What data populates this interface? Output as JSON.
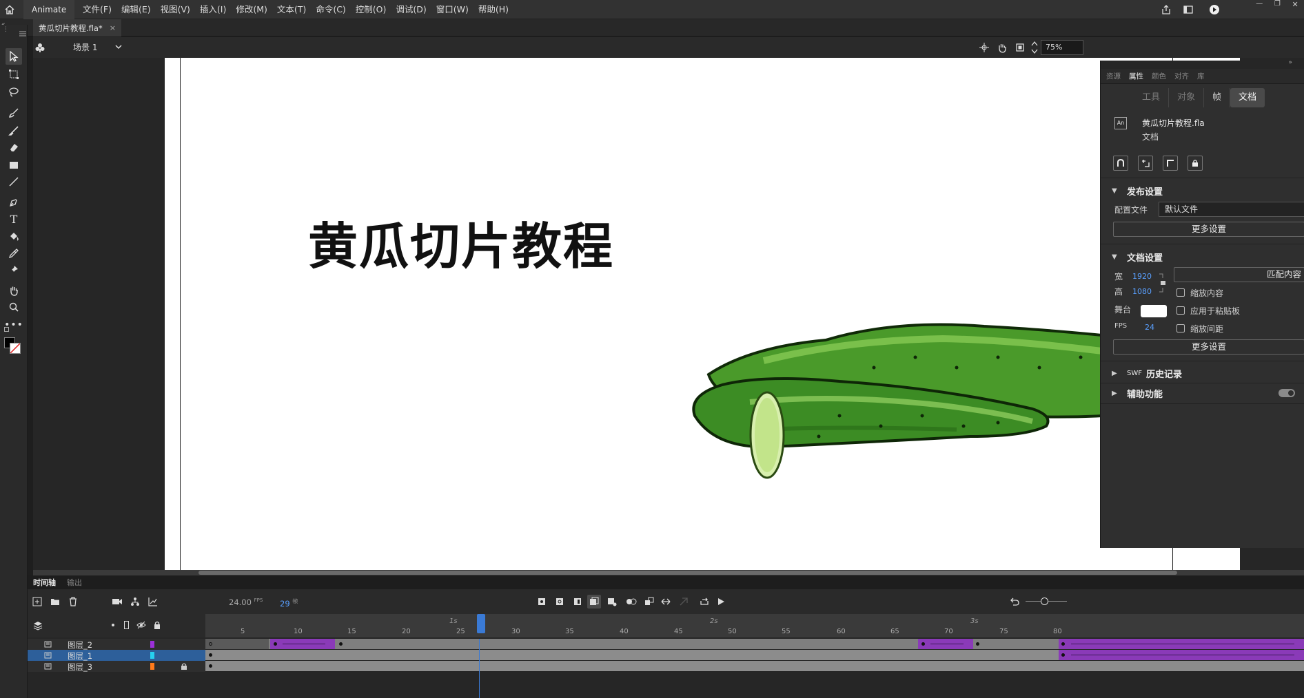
{
  "app": {
    "name": "Animate"
  },
  "menu": [
    "文件(F)",
    "编辑(E)",
    "视图(V)",
    "插入(I)",
    "修改(M)",
    "文本(T)",
    "命令(C)",
    "控制(O)",
    "调试(D)",
    "窗口(W)",
    "帮助(H)"
  ],
  "file_tab": {
    "name": "黄瓜切片教程.fla*",
    "close": "×"
  },
  "scene": {
    "name": "场景 1",
    "zoom": "75%"
  },
  "stage": {
    "title": "黄瓜切片教程"
  },
  "panel": {
    "tabs": [
      "资源",
      "属性",
      "颜色",
      "对齐",
      "库"
    ],
    "segments": [
      "工具",
      "对象",
      "帧",
      "文档"
    ],
    "doc_icon": "An",
    "doc_name": "黄瓜切片教程.fla",
    "doc_type": "文档",
    "publish": {
      "title": "发布设置",
      "profile_label": "配置文件",
      "profile_value": "默认文件",
      "more": "更多设置"
    },
    "doc_settings": {
      "title": "文档设置",
      "width_label": "宽",
      "width": "1920",
      "height_label": "高",
      "height": "1080",
      "match": "匹配内容",
      "scale_content": "缩放内容",
      "stage_label": "舞台",
      "apply_paste": "应用于粘贴板",
      "fps_label": "FPS",
      "fps": "24",
      "scale_spacing": "缩放间距",
      "more": "更多设置"
    },
    "swf_prefix": "SWF",
    "swf_history": "历史记录",
    "accessibility": "辅助功能"
  },
  "timeline": {
    "tabs": [
      "时间轴",
      "输出"
    ],
    "fps": "24.00",
    "fps_unit": "FPS",
    "frame": "29",
    "frame_unit": "帧",
    "ruler_numbers": [
      "5",
      "10",
      "15",
      "20",
      "25",
      "30",
      "35",
      "40",
      "45",
      "50",
      "55",
      "60",
      "65",
      "70",
      "75",
      "80"
    ],
    "ruler_seconds": [
      "1s",
      "2s",
      "3s"
    ],
    "layers": [
      {
        "name": "图层_2",
        "color": "#9b30d9"
      },
      {
        "name": "图层_1",
        "color": "#26d0f0"
      },
      {
        "name": "图层_3",
        "color": "#ff7a1a"
      }
    ]
  }
}
